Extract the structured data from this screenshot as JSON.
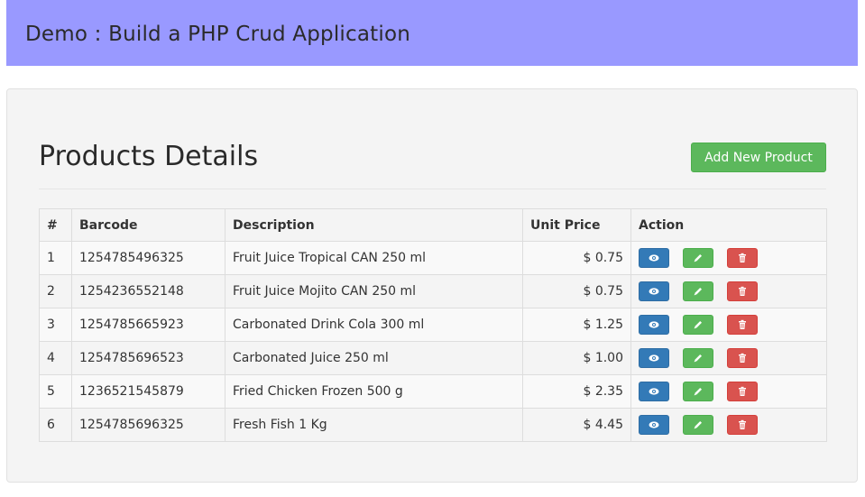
{
  "header": {
    "title": "Demo : Build a PHP Crud Application"
  },
  "main": {
    "title": "Products Details",
    "add_button_label": "Add New Product"
  },
  "table": {
    "headers": [
      "#",
      "Barcode",
      "Description",
      "Unit Price",
      "Action"
    ],
    "rows": [
      {
        "num": "1",
        "barcode": "1254785496325",
        "description": "Fruit Juice Tropical CAN 250 ml",
        "price": "$ 0.75"
      },
      {
        "num": "2",
        "barcode": "1254236552148",
        "description": "Fruit Juice Mojito CAN 250 ml",
        "price": "$ 0.75"
      },
      {
        "num": "3",
        "barcode": "1254785665923",
        "description": "Carbonated Drink Cola 300 ml",
        "price": "$ 1.25"
      },
      {
        "num": "4",
        "barcode": "1254785696523",
        "description": "Carbonated Juice 250 ml",
        "price": "$ 1.00"
      },
      {
        "num": "5",
        "barcode": "1236521545879",
        "description": "Fried Chicken Frozen 500 g",
        "price": "$ 2.35"
      },
      {
        "num": "6",
        "barcode": "1254785696325",
        "description": "Fresh Fish 1 Kg",
        "price": "$ 4.45"
      }
    ],
    "actions": [
      {
        "name": "view",
        "icon": "eye-icon",
        "color": "#337ab7"
      },
      {
        "name": "edit",
        "icon": "pencil-icon",
        "color": "#5cb85c"
      },
      {
        "name": "delete",
        "icon": "trash-icon",
        "color": "#d9534f"
      }
    ]
  },
  "colors": {
    "header_bg": "#9999ff",
    "primary": "#337ab7",
    "success": "#5cb85c",
    "danger": "#d9534f"
  }
}
